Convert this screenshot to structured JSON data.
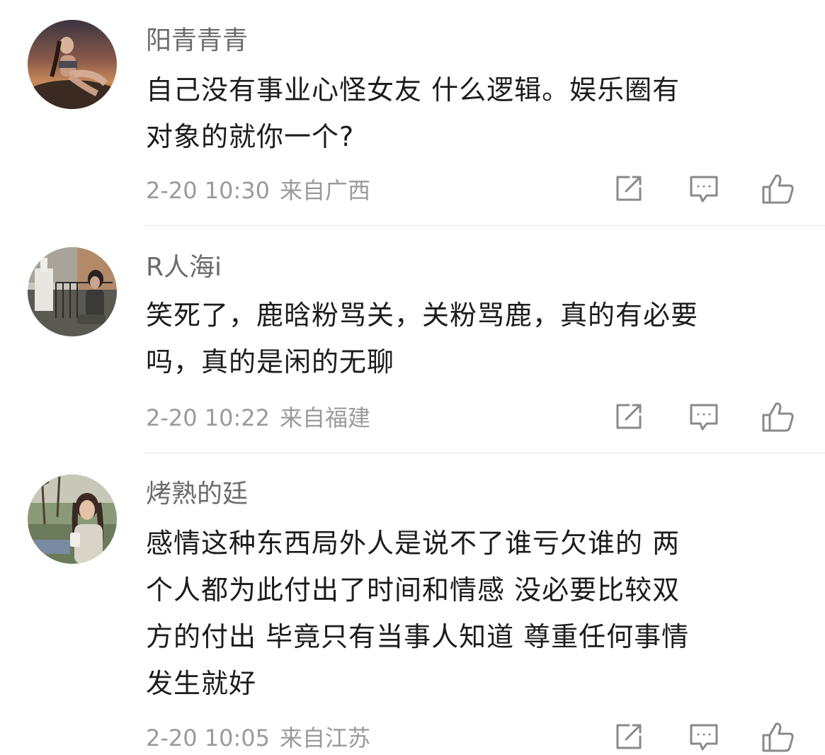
{
  "comments": [
    {
      "username": "阳青青青",
      "lines": [
        "自己没有事业心怪女友 什么逻辑。娱乐圈有",
        "对象的就你一个?"
      ],
      "time": "2-20 10:30",
      "location": "来自广西"
    },
    {
      "username": "R人海i",
      "lines": [
        "笑死了，鹿晗粉骂关，关粉骂鹿，真的有必要",
        "吗，真的是闲的无聊"
      ],
      "time": "2-20 10:22",
      "location": "来自福建"
    },
    {
      "username": "烤熟的廷",
      "lines": [
        "感情这种东西局外人是说不了谁亏欠谁的 两",
        "个人都为此付出了时间和情感 没必要比较双",
        "方的付出 毕竟只有当事人知道 尊重任何事情",
        "发生就好"
      ],
      "time": "2-20 10:05",
      "location": "来自江苏"
    }
  ],
  "icons": {
    "share": "share-icon",
    "reply": "comment-icon",
    "like": "thumbs-up-icon"
  },
  "colors": {
    "username": "#6b6b6b",
    "text": "#1c1c1c",
    "meta": "#9a9a9a",
    "icon": "#8a8a8a",
    "divider": "#e6e6e6"
  }
}
